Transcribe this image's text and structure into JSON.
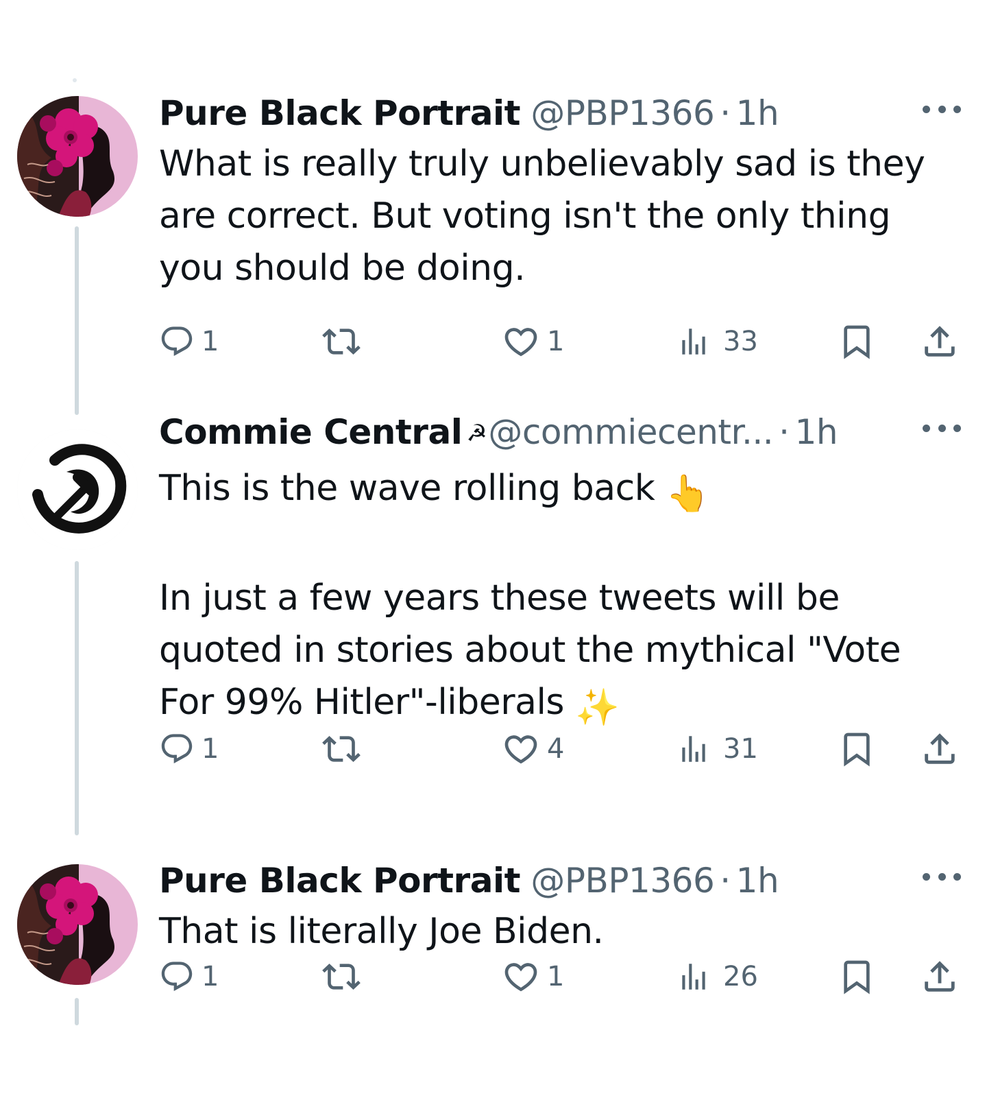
{
  "tweets": [
    {
      "name": "Pure Black Portrait",
      "handle": "@PBP1366",
      "separator": "·",
      "time": "1h",
      "badge": "",
      "text": "What is really truly unbelievably sad is they\nare correct. But voting isn't the only thing\nyou should be doing.",
      "avatar": "flower-portrait-avatar",
      "replies": "1",
      "retweets": "",
      "likes": "1",
      "views": "33"
    },
    {
      "name": "Commie Central",
      "handle": "@commiecentr...",
      "separator": "·",
      "time": "1h",
      "badge": "☭",
      "text_line1": "This is the wave rolling back ",
      "text_emoji1": "👆",
      "text_line2": "In just a few years these tweets will be\nquoted in stories about the mythical \"Vote\nFor 99% Hitler\"-liberals ",
      "text_emoji2": "✨",
      "avatar": "hammer-sickle-avatar",
      "replies": "1",
      "retweets": "",
      "likes": "4",
      "views": "31"
    },
    {
      "name": "Pure Black Portrait",
      "handle": "@PBP1366",
      "separator": "·",
      "time": "1h",
      "badge": "",
      "text": "That is literally Joe Biden.",
      "avatar": "flower-portrait-avatar",
      "replies": "1",
      "retweets": "",
      "likes": "1",
      "views": "26"
    }
  ],
  "colors": {
    "text_primary": "#0f1419",
    "text_secondary": "#536471",
    "thread_line": "#cfd9de",
    "avatar_bg_pink": "#e8b6d6",
    "flower_magenta": "#d4157a"
  },
  "icons": [
    "reply-icon",
    "retweet-icon",
    "like-icon",
    "views-icon",
    "bookmark-icon",
    "share-icon",
    "more-icon"
  ]
}
